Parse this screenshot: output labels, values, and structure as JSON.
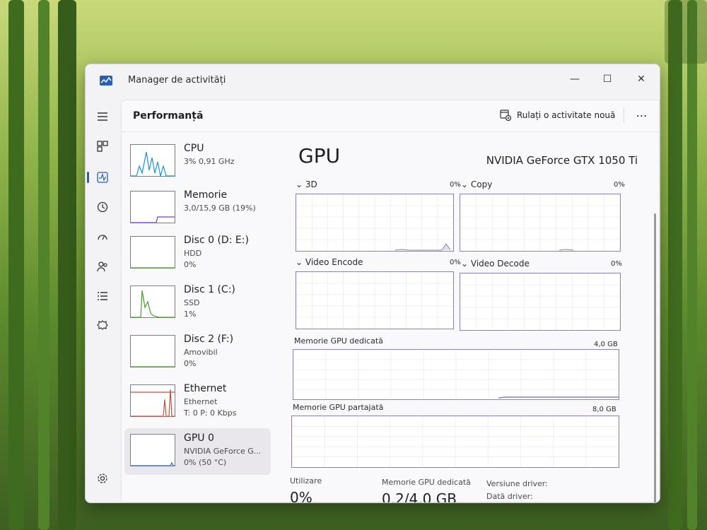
{
  "window": {
    "title": "Manager de activități",
    "minimize_icon": "—",
    "maximize_icon": "☐",
    "close_icon": "✕"
  },
  "header": {
    "title": "Performanță",
    "run_task_label": "Rulați o activitate nouă",
    "more_icon": "⋯"
  },
  "nav": {
    "items": [
      "menu-icon",
      "processes-icon",
      "performance-icon",
      "app-history-icon",
      "startup-apps-icon",
      "users-icon",
      "details-icon",
      "services-icon",
      "settings-icon"
    ],
    "active": "performance-icon"
  },
  "resources": [
    {
      "name": "CPU",
      "sub": "3% 0,91 GHz",
      "sub2": "",
      "color": "#1f8fd6",
      "level": 0.03
    },
    {
      "name": "Memorie",
      "sub": "3,0/15,9 GB (19%)",
      "sub2": "",
      "color": "#7a3fb0",
      "level": 0.19
    },
    {
      "name": "Disc 0 (D: E:)",
      "sub": "HDD",
      "sub2": "0%",
      "color": "#4b9a2b",
      "level": 0.0
    },
    {
      "name": "Disc 1 (C:)",
      "sub": "SSD",
      "sub2": "1%",
      "color": "#4b9a2b",
      "level": 0.01
    },
    {
      "name": "Disc 2 (F:)",
      "sub": "Amovibil",
      "sub2": "0%",
      "color": "#4b9a2b",
      "level": 0.0
    },
    {
      "name": "Ethernet",
      "sub": "Ethernet",
      "sub2": "T: 0 P: 0 Kbps",
      "color": "#b8543c",
      "level": 0.0
    },
    {
      "name": "GPU 0",
      "sub": "NVIDIA GeForce G...",
      "sub2": "0% (50 °C)",
      "color": "#2a5fb8",
      "level": 0.0
    }
  ],
  "gpu": {
    "title": "GPU",
    "model": "NVIDIA GeForce GTX 1050 Ti",
    "engines": [
      {
        "label": "3D",
        "pct": "0%"
      },
      {
        "label": "Copy",
        "pct": "0%"
      },
      {
        "label": "Video Encode",
        "pct": "0%"
      },
      {
        "label": "Video Decode",
        "pct": "0%"
      }
    ],
    "dedicated_label": "Memorie GPU dedicată",
    "dedicated_max": "4,0 GB",
    "shared_label": "Memorie GPU partajată",
    "shared_max": "8,0 GB",
    "stats": {
      "util_label": "Utilizare",
      "util_value": "0%",
      "ded_label": "Memorie GPU dedicată",
      "ded_value": "0,2/4,0 GB",
      "driver_label": "Versiune driver:",
      "date_label": "Dată driver:"
    }
  },
  "colors": {
    "accent": "#2a5fb8",
    "gpu_graph_line": "#8b7fbd"
  }
}
